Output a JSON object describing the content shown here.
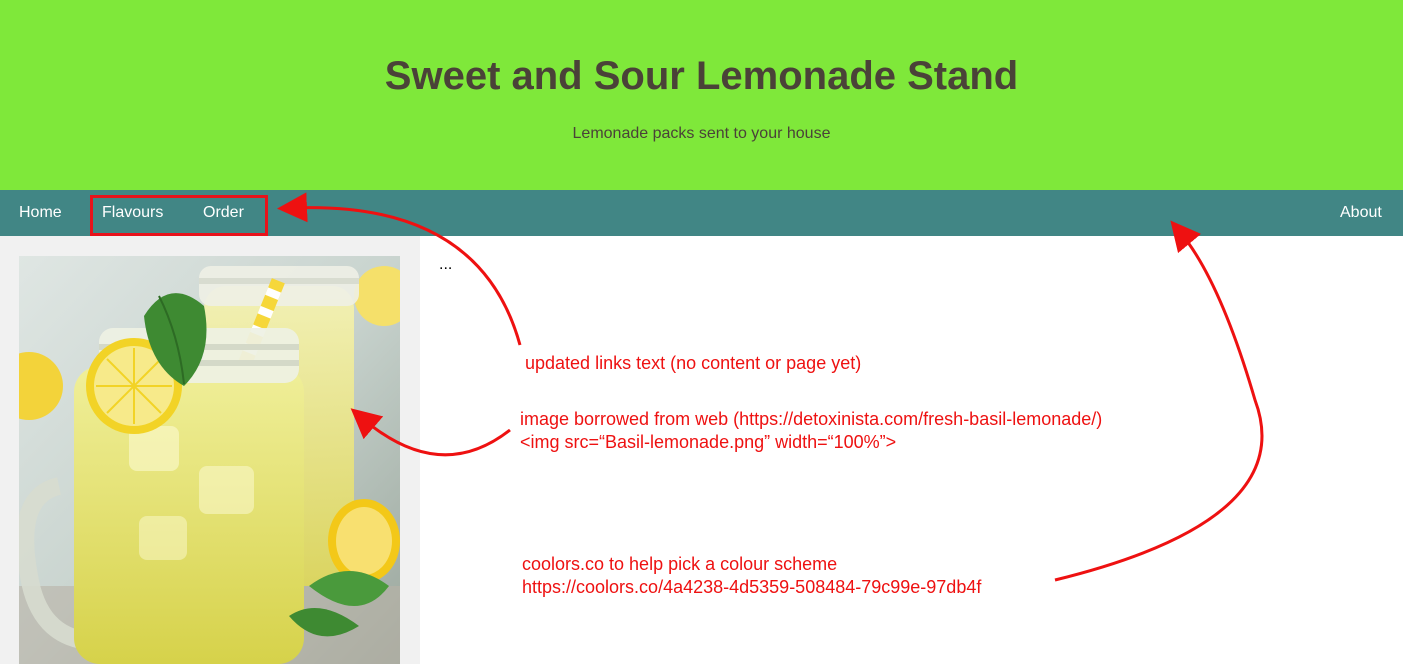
{
  "header": {
    "title": "Sweet and Sour Lemonade Stand",
    "subtitle": "Lemonade packs sent to your house"
  },
  "nav": {
    "home": "Home",
    "flavours": "Flavours",
    "order": "Order",
    "about": "About"
  },
  "main": {
    "content_text": "..."
  },
  "photo": {
    "alt": "Glass jar of basil lemonade with lemon slice, mint leaf and yellow striped straw"
  },
  "annotations": {
    "links_note": "updated links text (no content or page yet)",
    "image_note_line1": "image borrowed from web (https://detoxinista.com/fresh-basil-lemonade/)",
    "image_note_line2": "<img src=“Basil-lemonade.png” width=“100%”>",
    "colour_note_line1": "coolors.co to help pick a colour scheme",
    "colour_note_line2": "https://coolors.co/4a4238-4d5359-508484-79c99e-97db4f"
  },
  "colors": {
    "header_bg": "#7fe83a",
    "nav_bg": "#418685",
    "title_text": "#4a4238",
    "annotation": "#ee1111",
    "sidebar_bg": "#f1f1f1"
  }
}
